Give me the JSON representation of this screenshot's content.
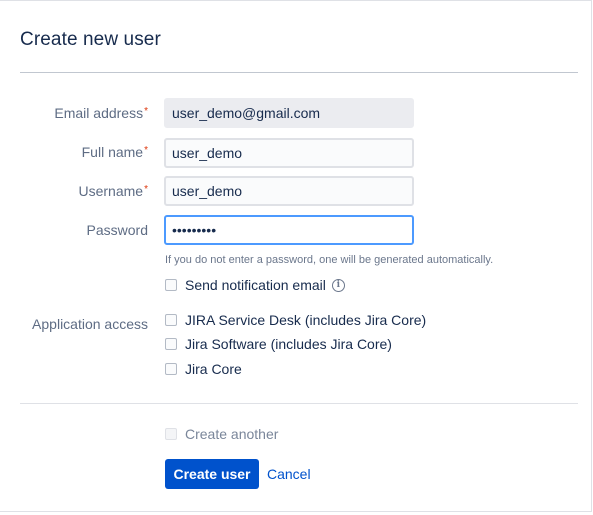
{
  "dialog": {
    "title": "Create new user"
  },
  "form": {
    "email": {
      "label": "Email address",
      "required": "*",
      "value": "user_demo@gmail.com"
    },
    "full_name": {
      "label": "Full name",
      "required": "*",
      "value": "user_demo"
    },
    "username": {
      "label": "Username",
      "required": "*",
      "value": "user_demo"
    },
    "password": {
      "label": "Password",
      "value": "•••••••••",
      "hint": "If you do not enter a password, one will be generated automatically."
    },
    "send_notification": {
      "label": "Send notification email",
      "checked": false,
      "icon": "info-icon",
      "icon_glyph": "i"
    },
    "application_access": {
      "label": "Application access",
      "options": [
        {
          "label": "JIRA Service Desk (includes Jira Core)",
          "checked": false
        },
        {
          "label": "Jira Software (includes Jira Core)",
          "checked": false
        },
        {
          "label": "Jira Core",
          "checked": false
        }
      ]
    }
  },
  "footer": {
    "create_another": {
      "label": "Create another",
      "checked": false,
      "disabled": true
    },
    "create_button": "Create user",
    "cancel_link": "Cancel"
  },
  "colors": {
    "primary": "#0052cc",
    "required": "#de350b",
    "focus_border": "#4c9aff"
  }
}
